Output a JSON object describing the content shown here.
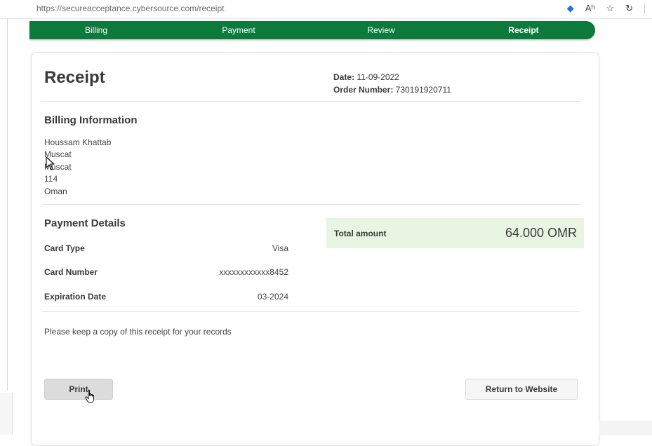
{
  "browser": {
    "url": "https://secureacceptance.cybersource.com/receipt",
    "icons": [
      "tag-icon",
      "read-aloud-icon",
      "favorite-icon",
      "copilot-icon"
    ]
  },
  "steps": [
    {
      "label": "Billing",
      "active": false
    },
    {
      "label": "Payment",
      "active": false
    },
    {
      "label": "Review",
      "active": false
    },
    {
      "label": "Receipt",
      "active": true
    }
  ],
  "receipt": {
    "title": "Receipt",
    "date_label": "Date:",
    "date_value": "11-09-2022",
    "order_label": "Order Number:",
    "order_value": "730191920711"
  },
  "billing": {
    "heading": "Billing Information",
    "lines": [
      "Houssam Khattab",
      "Muscat",
      "Muscat",
      "114",
      "Oman"
    ]
  },
  "payment": {
    "heading": "Payment Details",
    "rows": [
      {
        "label": "Card Type",
        "value": "Visa"
      },
      {
        "label": "Card Number",
        "value": "xxxxxxxxxxxx8452"
      },
      {
        "label": "Expiration Date",
        "value": "03-2024"
      }
    ],
    "total_label": "Total amount",
    "total_value": "64.000 OMR"
  },
  "note": "Please keep a copy of this receipt for your records",
  "buttons": {
    "print": "Print",
    "return": "Return to Website"
  },
  "colors": {
    "brand_green": "#0b7a3b",
    "total_bg": "#e8f5e3"
  }
}
